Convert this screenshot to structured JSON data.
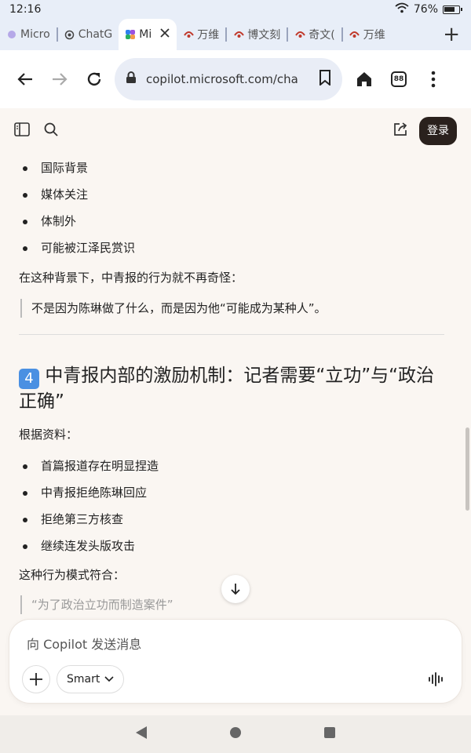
{
  "status": {
    "time": "12:16",
    "battery": "76%"
  },
  "tabs": [
    {
      "label": "Micro",
      "icon": "copilot-icon"
    },
    {
      "label": "ChatG",
      "icon": "chatgpt-icon"
    },
    {
      "label": "Mi",
      "icon": "copilot-icon",
      "active": true
    },
    {
      "label": "万维",
      "icon": "site-icon"
    },
    {
      "label": "博文刻",
      "icon": "site-icon"
    },
    {
      "label": "奇文(",
      "icon": "site-icon"
    },
    {
      "label": "万维",
      "icon": "site-icon"
    }
  ],
  "toolbar": {
    "url": "copilot.microsoft.com/cha",
    "tab_count": "88"
  },
  "header": {
    "login_label": "登录"
  },
  "content": {
    "bullets_1": [
      "国际背景",
      "媒体关注",
      "体制外",
      "可能被江泽民赏识"
    ],
    "para_1": "在这种背景下，中青报的行为就不再奇怪：",
    "quote_1": "不是因为陈琳做了什么，而是因为他“可能成为某种人”。",
    "heading_num": "4",
    "heading_text": "中青报内部的激励机制：记者需要“立功”与“政治正确”",
    "para_2": "根据资料：",
    "bullets_2": [
      "首篇报道存在明显捏造",
      "中青报拒绝陈琳回应",
      "拒绝第三方核查",
      "继续连发头版攻击"
    ],
    "para_3": "这种行为模式符合：",
    "quote_2": "“为了政治立功而制造案件”"
  },
  "composer": {
    "placeholder": "向 Copilot 发送消息",
    "mode_label": "Smart"
  },
  "colors": {
    "login_bg": "#2a211d",
    "page_bg": "#faf6f2",
    "keycap": "#4a90e2"
  }
}
